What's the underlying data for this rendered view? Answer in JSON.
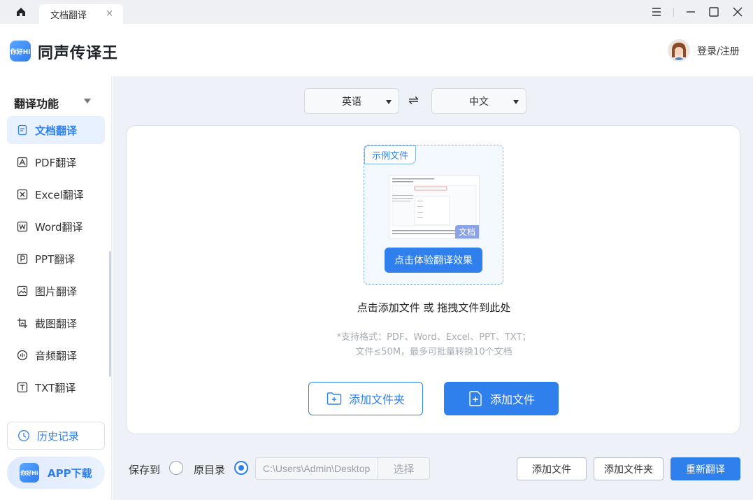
{
  "titlebar": {
    "tab_label": "文档翻译",
    "tab_close": "×"
  },
  "header": {
    "app_name": "同声传译王",
    "logo_text": "你好Hi",
    "login_label": "登录/注册"
  },
  "sidebar": {
    "title": "翻译功能",
    "items": [
      {
        "label": "文档翻译",
        "icon": "document-icon",
        "active": true
      },
      {
        "label": "PDF翻译",
        "icon": "pdf-icon"
      },
      {
        "label": "Excel翻译",
        "icon": "excel-icon"
      },
      {
        "label": "Word翻译",
        "icon": "word-icon"
      },
      {
        "label": "PPT翻译",
        "icon": "ppt-icon"
      },
      {
        "label": "图片翻译",
        "icon": "image-icon"
      },
      {
        "label": "截图翻译",
        "icon": "screenshot-icon"
      },
      {
        "label": "音频翻译",
        "icon": "audio-icon"
      },
      {
        "label": "TXT翻译",
        "icon": "txt-icon"
      }
    ],
    "history_label": "历史记录",
    "app_download_label": "APP下载"
  },
  "main": {
    "source_lang": "英语",
    "target_lang": "中文",
    "swap_glyph": "⇌",
    "sample_tag": "示例文件",
    "sample_badge": "文档",
    "try_button": "点击体验翻译效果",
    "drop_hint": "点击添加文件 或 拖拽文件到此处",
    "formats": "*支持格式：PDF、Word、Excel、PPT、TXT；",
    "limits": "文件≤50M，最多可批量转换10个文档",
    "add_folder_button": "添加文件夹",
    "add_file_button": "添加文件"
  },
  "bottom": {
    "save_to_label": "保存到",
    "original_dir_label": "原目录",
    "save_option": "原目录",
    "path_value": "C:\\Users\\Admin\\Desktop",
    "choose_button": "选择",
    "add_file_button": "添加文件",
    "add_folder_button": "添加文件夹",
    "retranslate_button": "重新翻译"
  },
  "colors": {
    "accent": "#2f80ed",
    "main_bg": "#eef2f8"
  }
}
